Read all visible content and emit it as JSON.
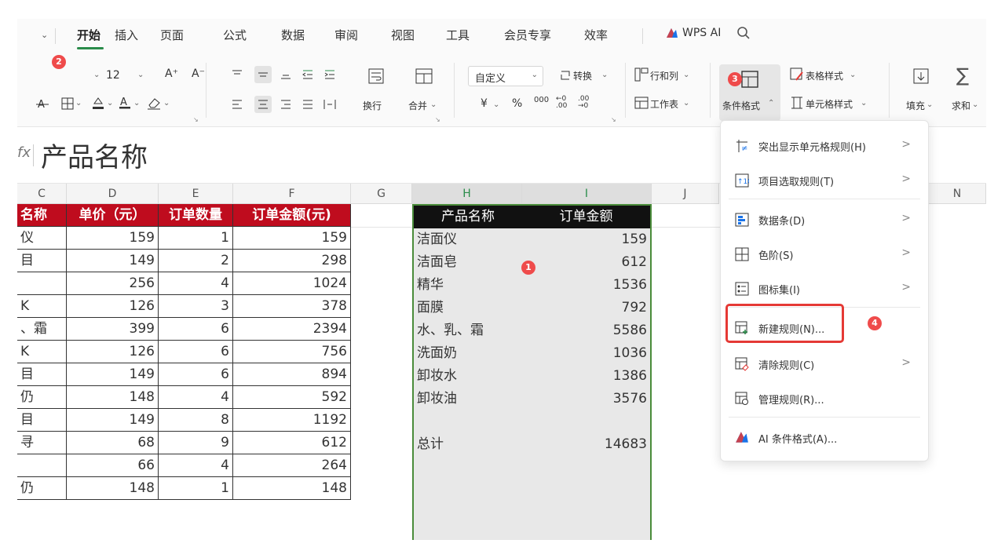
{
  "menu": {
    "tabs": [
      "开始",
      "插入",
      "页面",
      "公式",
      "数据",
      "审阅",
      "视图",
      "工具",
      "会员专享",
      "效率"
    ],
    "wps_ai": "WPS AI"
  },
  "ribbon": {
    "font_size": "12",
    "font_grow": "A⁺",
    "font_shrink": "A⁻",
    "wrap_label": "换行",
    "merge_label": "合并",
    "number_format": "自定义",
    "convert_label": "转换",
    "currency": "¥",
    "percent": "%",
    "thousands": "000",
    "dec_inc": "←0 .00",
    "dec_dec": ".00 →0",
    "rows_cols": "行和列",
    "worksheet": "工作表",
    "conditional_format": "条件格式",
    "table_style": "表格样式",
    "cell_style": "单元格样式",
    "fill": "填充",
    "sum": "求和"
  },
  "formula": {
    "fx": "fx",
    "content": "产品名称"
  },
  "columns": [
    "C",
    "D",
    "E",
    "F",
    "G",
    "H",
    "I",
    "J",
    "N"
  ],
  "left_table": {
    "headers": [
      "名称",
      "单价（元）",
      "订单数量",
      "订单金额(元)"
    ],
    "rows": [
      [
        "仪",
        "159",
        "1",
        "159"
      ],
      [
        "目",
        "149",
        "2",
        "298"
      ],
      [
        "",
        "256",
        "4",
        "1024"
      ],
      [
        "K",
        "126",
        "3",
        "378"
      ],
      [
        "、霜",
        "399",
        "6",
        "2394"
      ],
      [
        "K",
        "126",
        "6",
        "756"
      ],
      [
        "目",
        "149",
        "6",
        "894"
      ],
      [
        "仍",
        "148",
        "4",
        "592"
      ],
      [
        "目",
        "149",
        "8",
        "1192"
      ],
      [
        "寻",
        "68",
        "9",
        "612"
      ],
      [
        "",
        "66",
        "4",
        "264"
      ],
      [
        "仍",
        "148",
        "1",
        "148"
      ]
    ]
  },
  "right_table": {
    "headers": [
      "产品名称",
      "订单金额"
    ],
    "rows": [
      [
        "洁面仪",
        "159"
      ],
      [
        "洁面皂",
        "612"
      ],
      [
        "精华",
        "1536"
      ],
      [
        "面膜",
        "792"
      ],
      [
        "水、乳、霜",
        "5586"
      ],
      [
        "洗面奶",
        "1036"
      ],
      [
        "卸妆水",
        "1386"
      ],
      [
        "卸妆油",
        "3576"
      ]
    ],
    "total_label": "总计",
    "total_value": "14683"
  },
  "dropdown": {
    "items": [
      {
        "label": "突出显示单元格规则(H)",
        "arrow": true
      },
      {
        "label": "项目选取规则(T)",
        "arrow": true
      },
      {
        "label": "数据条(D)",
        "arrow": true
      },
      {
        "label": "色阶(S)",
        "arrow": true
      },
      {
        "label": "图标集(I)",
        "arrow": true
      },
      {
        "label": "新建规则(N)...",
        "arrow": false
      },
      {
        "label": "清除规则(C)",
        "arrow": true
      },
      {
        "label": "管理规则(R)...",
        "arrow": false
      },
      {
        "label": "AI 条件格式(A)...",
        "arrow": false
      }
    ],
    "arrow_glyph": ">"
  },
  "markers": [
    "1",
    "2",
    "3",
    "4"
  ],
  "colors": {
    "header_red": "#bf0c1e",
    "accent_green": "#2a8c4a",
    "marker_red": "#ef4b4b"
  }
}
